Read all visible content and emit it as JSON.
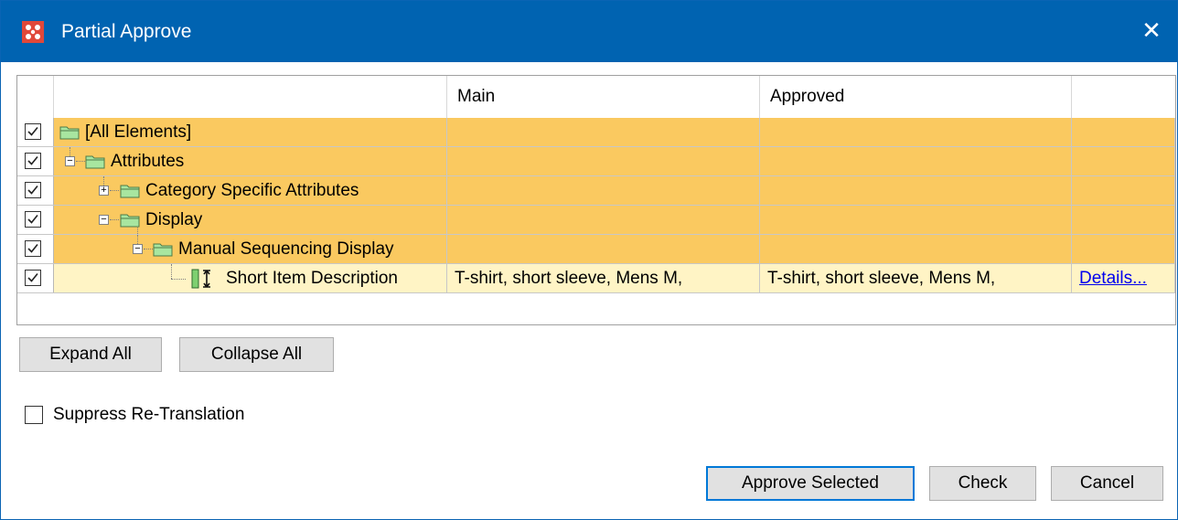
{
  "window": {
    "title": "Partial Approve",
    "close_glyph": "✕"
  },
  "grid": {
    "columns": [
      "",
      "Main",
      "Approved",
      ""
    ],
    "rows": [
      {
        "label": "[All Elements]",
        "checked": true,
        "main": "",
        "approved": "",
        "details": ""
      },
      {
        "label": "Attributes",
        "checked": true,
        "expander": "−",
        "main": "",
        "approved": "",
        "details": ""
      },
      {
        "label": "Category Specific Attributes",
        "checked": true,
        "expander": "+",
        "main": "",
        "approved": "",
        "details": ""
      },
      {
        "label": "Display",
        "checked": true,
        "expander": "−",
        "main": "",
        "approved": "",
        "details": ""
      },
      {
        "label": "Manual Sequencing Display",
        "checked": true,
        "expander": "−",
        "main": "",
        "approved": "",
        "details": ""
      },
      {
        "label": "Short Item Description",
        "checked": true,
        "main": "T-shirt, short sleeve, Mens M,",
        "approved": "T-shirt, short sleeve, Mens M,",
        "details": "Details..."
      }
    ]
  },
  "buttons": {
    "expand_all": "Expand All",
    "collapse_all": "Collapse All",
    "approve_selected": "Approve Selected",
    "check": "Check",
    "cancel": "Cancel"
  },
  "suppress": {
    "label": "Suppress Re-Translation",
    "checked": false
  },
  "colors": {
    "titlebar": "#0063b1",
    "row_orange": "#fac960",
    "row_light": "#fff4c5",
    "folder": "#a8e6a0",
    "link": "#0000ee"
  },
  "icons": {
    "app": "app-logo-icon",
    "close": "close-icon",
    "folder": "folder-icon",
    "field": "text-field-icon",
    "check": "checkmark-icon"
  }
}
